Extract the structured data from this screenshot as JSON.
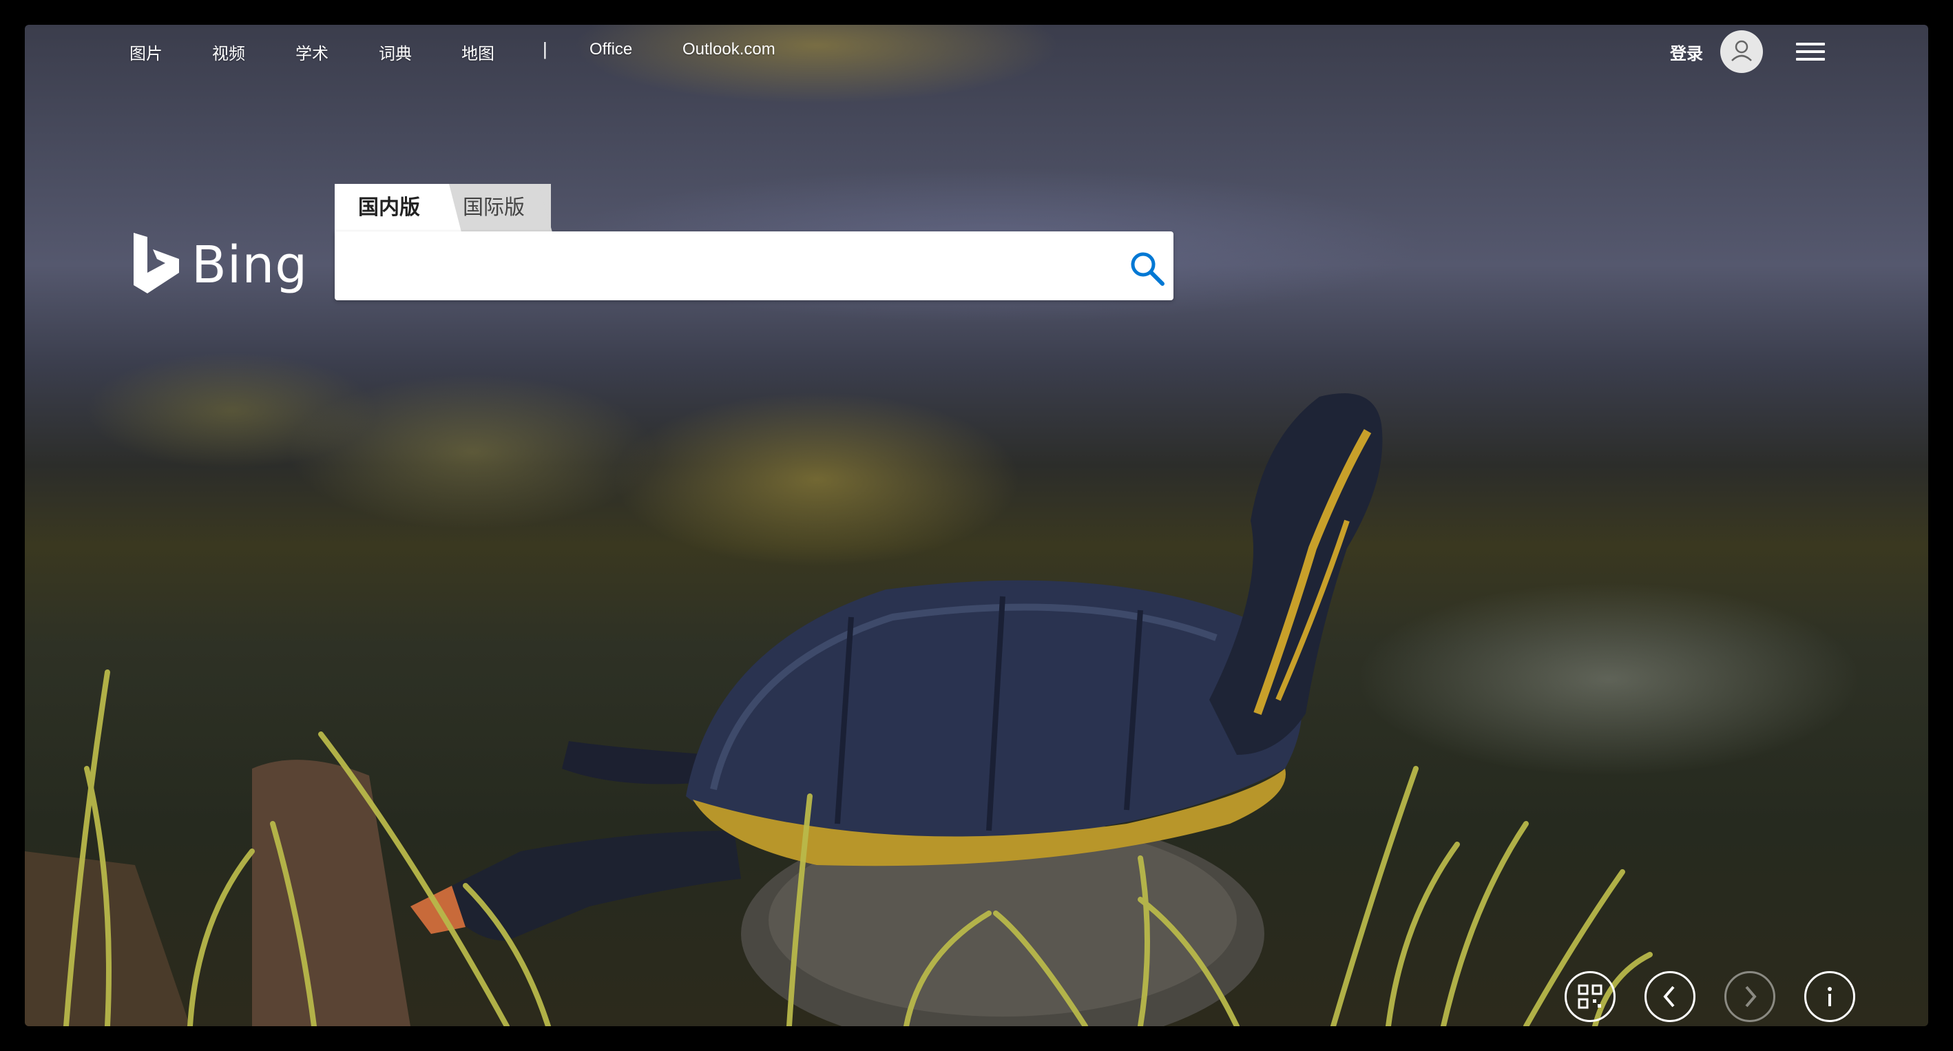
{
  "topnav": {
    "links": [
      "图片",
      "视频",
      "学术",
      "词典",
      "地图"
    ],
    "separator": "|",
    "office": "Office",
    "outlook": "Outlook.com",
    "login": "登录"
  },
  "logo": {
    "text": "Bing"
  },
  "search": {
    "tabs": [
      "国内版",
      "国际版"
    ],
    "active_tab": "国内版",
    "value": "",
    "placeholder": ""
  },
  "colors": {
    "accent": "#0078d4",
    "tab_active_bg": "#ffffff",
    "tab_inactive_bg": "#d9d9d9"
  },
  "icons": {
    "search": "search-icon",
    "avatar": "user-icon",
    "menu": "hamburger-icon",
    "qr": "qr-code-icon",
    "prev": "chevron-left-icon",
    "next": "chevron-right-icon",
    "info": "info-icon"
  }
}
